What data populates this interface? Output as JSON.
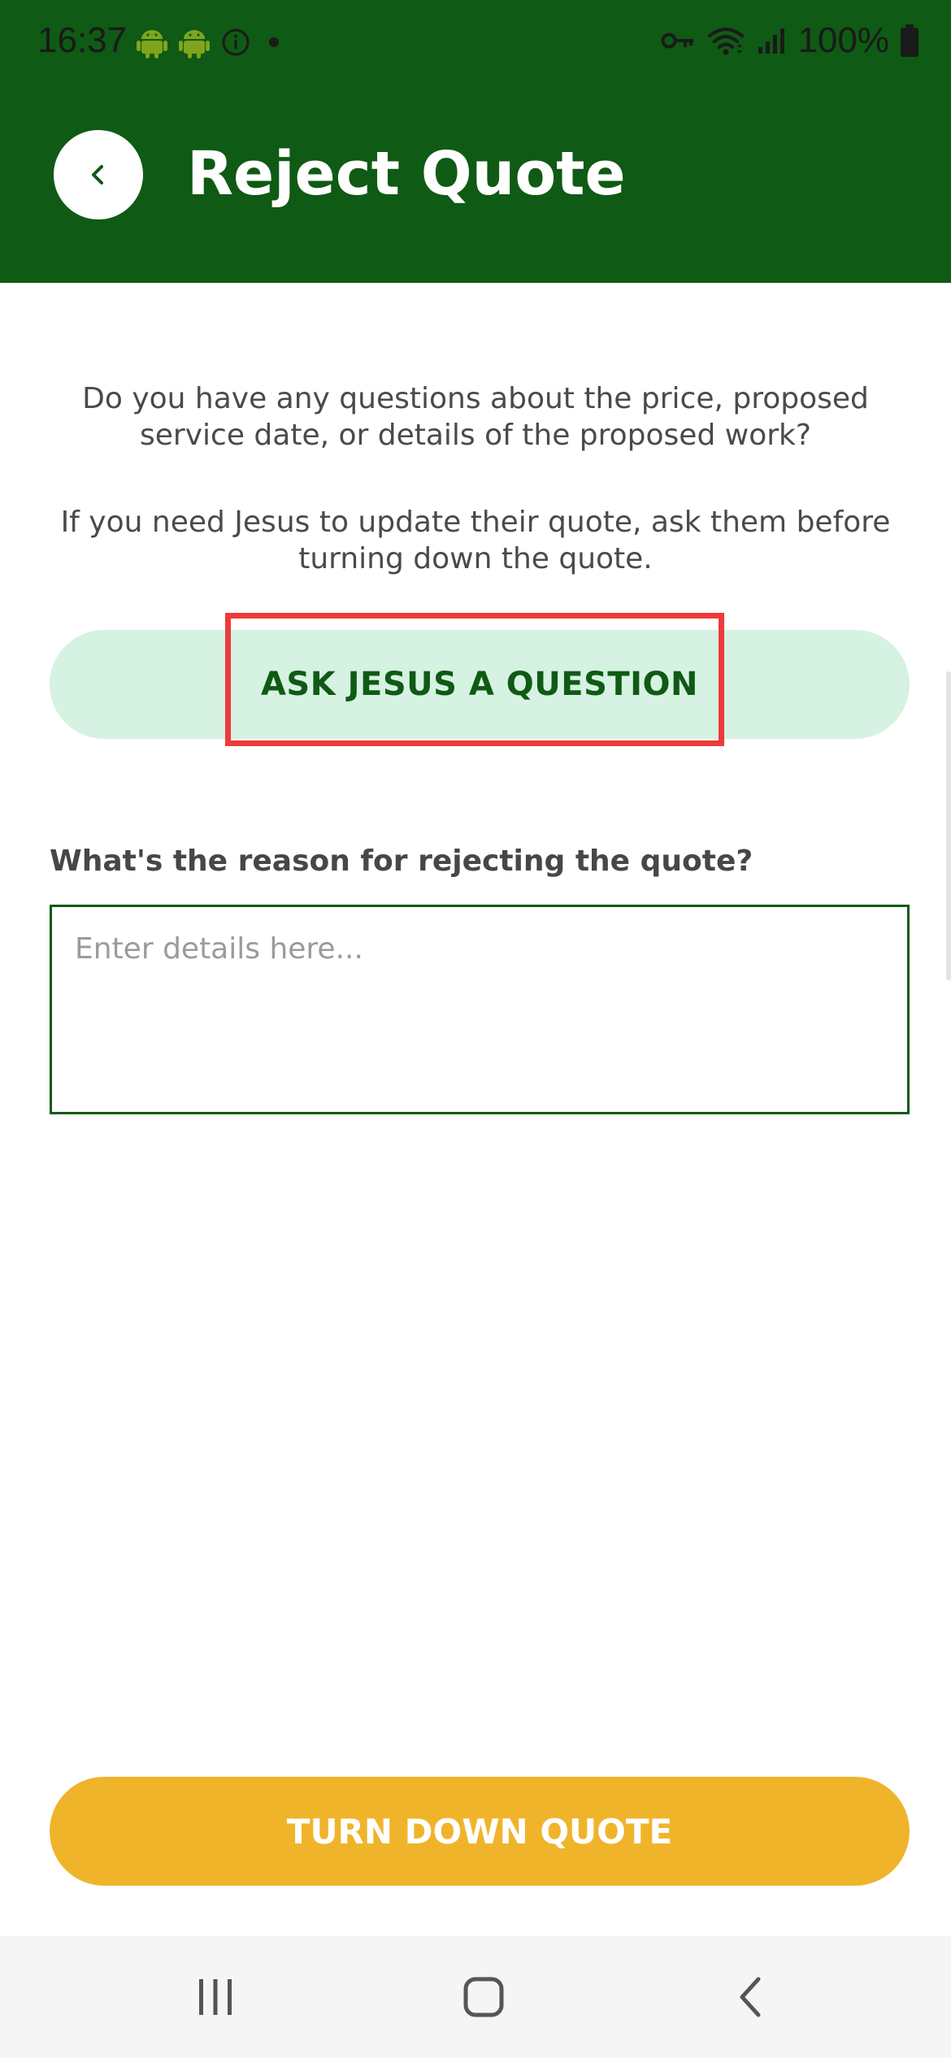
{
  "status_bar": {
    "time": "16:37",
    "battery": "100%",
    "icons": [
      "android-icon",
      "android-icon",
      "info-icon",
      "dot-icon",
      "vpn-key-icon",
      "wifi-icon",
      "signal-icon",
      "battery-icon"
    ]
  },
  "header": {
    "title": "Reject Quote",
    "back_icon": "chevron-left-icon"
  },
  "content": {
    "intro_line": "Do you have any questions about the price, proposed service date, or details of the proposed work?",
    "update_line": "If you need Jesus to update their quote, ask them before turning down the quote.",
    "ask_button_label": "ASK JESUS A QUESTION",
    "reason_label": "What's the reason for rejecting the quote?",
    "reason_placeholder": "Enter details here...",
    "reason_value": "",
    "turn_down_label": "TURN DOWN QUOTE"
  },
  "nav_bar": {
    "icons": [
      "recent-apps-icon",
      "home-icon",
      "back-icon"
    ]
  },
  "colors": {
    "header_green": "#0f5a14",
    "ask_button_bg": "#d6f2e2",
    "turn_down_bg": "#f0b42b",
    "highlight_red": "#ee3a3a"
  }
}
